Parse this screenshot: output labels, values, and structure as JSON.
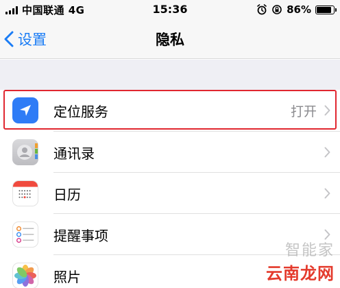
{
  "status_bar": {
    "carrier": "中国联通 4G",
    "time": "15:36",
    "battery": "86%",
    "battery_level": 0.86,
    "icons": [
      "signal-icon",
      "alarm-icon",
      "orientation-lock-icon",
      "battery-icon"
    ]
  },
  "nav": {
    "back_label": "设置",
    "title": "隐私"
  },
  "list": {
    "items": [
      {
        "label": "定位服务",
        "value": "打开",
        "icon": "location-arrow-icon",
        "icon_color": "#2f7cf6"
      },
      {
        "label": "通讯录",
        "value": "",
        "icon": "contacts-icon",
        "icon_color": "#c9c9cc"
      },
      {
        "label": "日历",
        "value": "",
        "icon": "calendar-icon",
        "icon_color": "#ffffff"
      },
      {
        "label": "提醒事项",
        "value": "",
        "icon": "reminders-icon",
        "icon_color": "#ffffff"
      },
      {
        "label": "照片",
        "value": "",
        "icon": "photos-icon",
        "icon_color": "#ffffff"
      }
    ]
  },
  "highlight_color": "#e0262f",
  "watermark": {
    "top": "智能家",
    "bottom": "云南龙网"
  }
}
